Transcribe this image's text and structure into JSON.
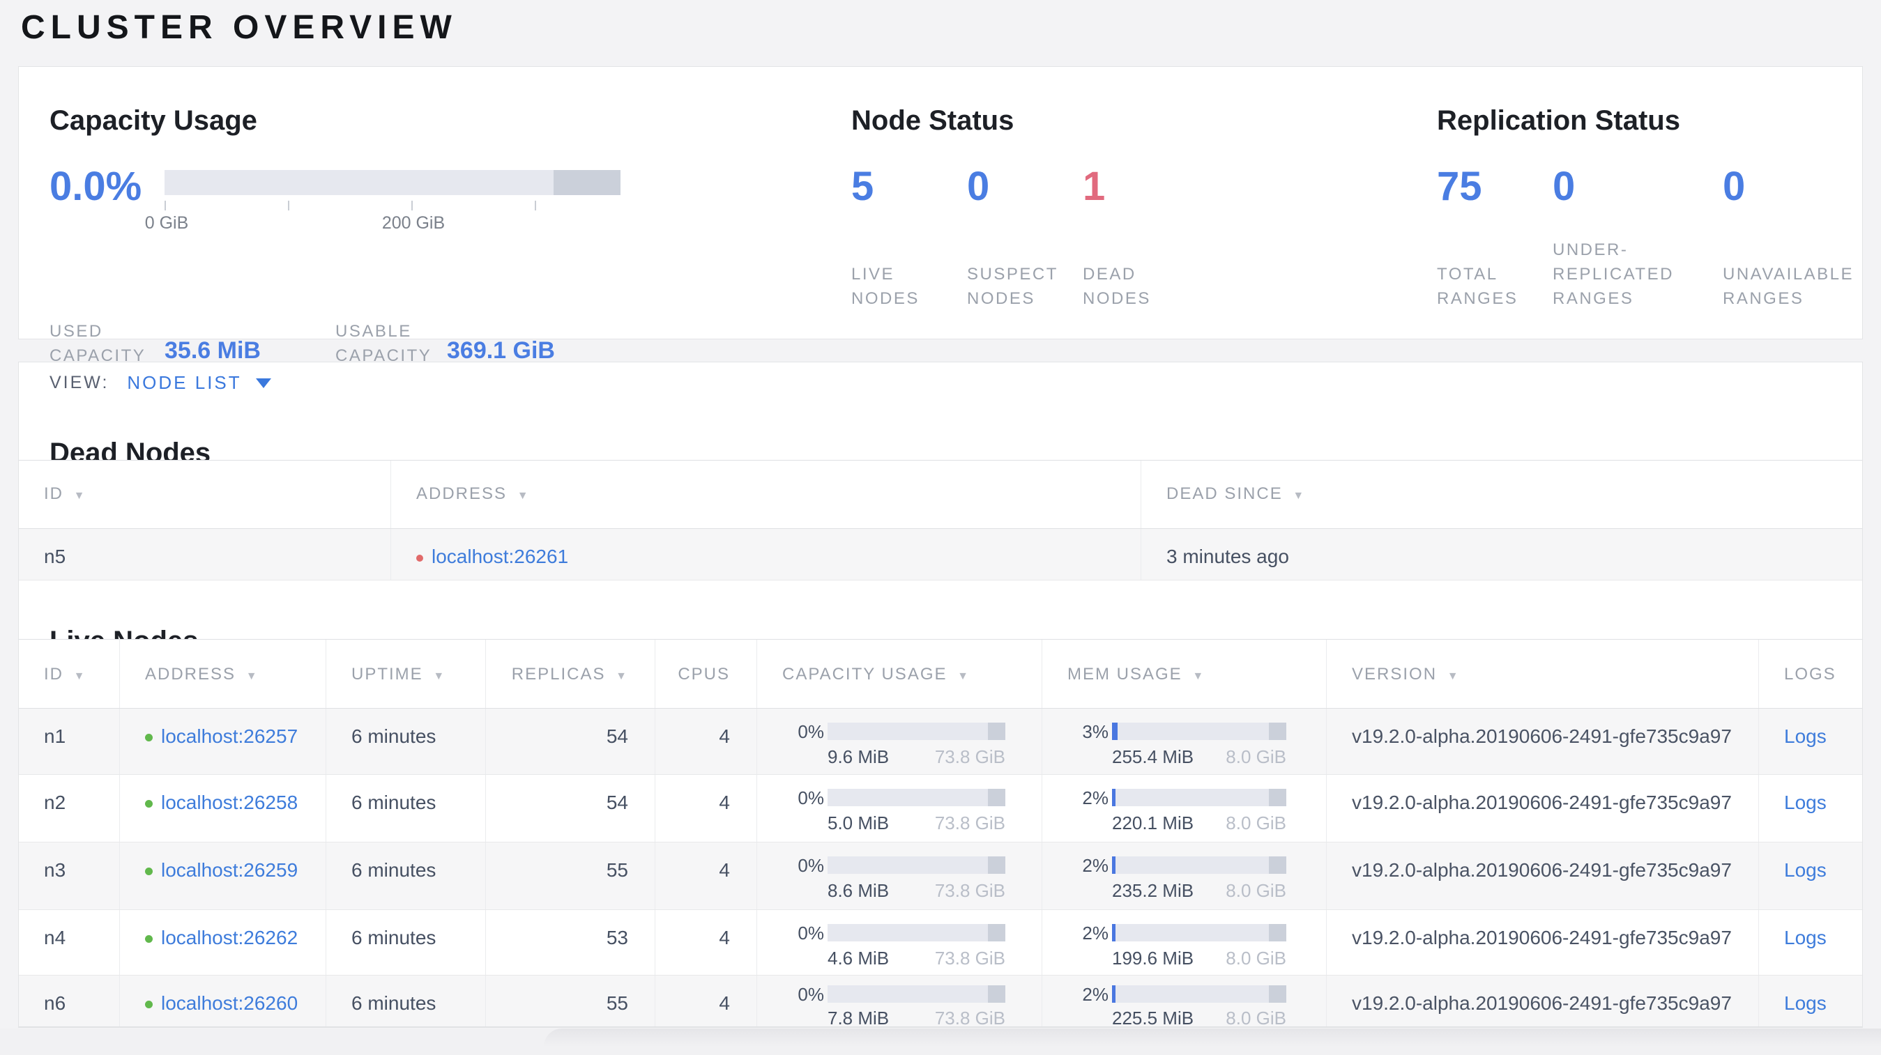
{
  "page_title": "CLUSTER OVERVIEW",
  "icons": {
    "sort_arrow": "▼",
    "live_dot": "green-circle",
    "dead_dot": "red-circle",
    "dropdown_caret": "triangle-down"
  },
  "colors": {
    "accent_blue": "#4a7de2",
    "link_blue": "#3e7cdb",
    "danger_red": "#e16a7e",
    "green_dot": "#61b84c",
    "red_dot": "#e16a6a",
    "bar_track": "#e6e8ef",
    "bar_dark": "#cbd0da",
    "bar_fill": "#4a77e0"
  },
  "summary": {
    "capacity": {
      "title": "Capacity Usage",
      "percent": "0.0%",
      "ticks": [
        "0 GiB",
        "200 GiB"
      ],
      "used_label": "USED CAPACITY",
      "used_value": "35.6 MiB",
      "usable_label": "USABLE CAPACITY",
      "usable_value": "369.1 GiB"
    },
    "node_status": {
      "title": "Node Status",
      "stats": [
        {
          "value": "5",
          "label": "LIVE NODES"
        },
        {
          "value": "0",
          "label": "SUSPECT NODES"
        },
        {
          "value": "1",
          "label": "DEAD NODES"
        }
      ]
    },
    "replication": {
      "title": "Replication Status",
      "stats": [
        {
          "value": "75",
          "label": "TOTAL RANGES"
        },
        {
          "value": "0",
          "label": "UNDER-REPLICATED RANGES"
        },
        {
          "value": "0",
          "label": "UNAVAILABLE RANGES"
        }
      ]
    }
  },
  "view_bar": {
    "label": "VIEW:",
    "selected": "NODE LIST"
  },
  "dead_nodes": {
    "title": "Dead Nodes",
    "columns": [
      {
        "label": "ID",
        "sortable": true
      },
      {
        "label": "ADDRESS",
        "sortable": true
      },
      {
        "label": "DEAD SINCE",
        "sortable": true
      }
    ],
    "rows": [
      {
        "id": "n5",
        "address": "localhost:26261",
        "dead_since": "3 minutes ago"
      }
    ]
  },
  "live_nodes": {
    "title": "Live Nodes",
    "columns": [
      {
        "label": "ID",
        "sortable": true
      },
      {
        "label": "ADDRESS",
        "sortable": true
      },
      {
        "label": "UPTIME",
        "sortable": true
      },
      {
        "label": "REPLICAS",
        "sortable": true
      },
      {
        "label": "CPUS",
        "sortable": false
      },
      {
        "label": "CAPACITY USAGE",
        "sortable": true
      },
      {
        "label": "MEM USAGE",
        "sortable": true
      },
      {
        "label": "VERSION",
        "sortable": true
      },
      {
        "label": "LOGS",
        "sortable": false
      }
    ],
    "logs_label": "Logs",
    "rows": [
      {
        "id": "n1",
        "address": "localhost:26257",
        "uptime": "6 minutes",
        "replicas": "54",
        "cpus": "4",
        "capacity_percent": "0%",
        "capacity_fill": 0,
        "capacity_used": "9.6 MiB",
        "capacity_total": "73.8 GiB",
        "mem_percent": "3%",
        "mem_fill": 3,
        "mem_used": "255.4 MiB",
        "mem_total": "8.0 GiB",
        "version": "v19.2.0-alpha.20190606-2491-gfe735c9a97",
        "logs": "Logs"
      },
      {
        "id": "n2",
        "address": "localhost:26258",
        "uptime": "6 minutes",
        "replicas": "54",
        "cpus": "4",
        "capacity_percent": "0%",
        "capacity_fill": 0,
        "capacity_used": "5.0 MiB",
        "capacity_total": "73.8 GiB",
        "mem_percent": "2%",
        "mem_fill": 2,
        "mem_used": "220.1 MiB",
        "mem_total": "8.0 GiB",
        "version": "v19.2.0-alpha.20190606-2491-gfe735c9a97",
        "logs": "Logs"
      },
      {
        "id": "n3",
        "address": "localhost:26259",
        "uptime": "6 minutes",
        "replicas": "55",
        "cpus": "4",
        "capacity_percent": "0%",
        "capacity_fill": 0,
        "capacity_used": "8.6 MiB",
        "capacity_total": "73.8 GiB",
        "mem_percent": "2%",
        "mem_fill": 2,
        "mem_used": "235.2 MiB",
        "mem_total": "8.0 GiB",
        "version": "v19.2.0-alpha.20190606-2491-gfe735c9a97",
        "logs": "Logs"
      },
      {
        "id": "n4",
        "address": "localhost:26262",
        "uptime": "6 minutes",
        "replicas": "53",
        "cpus": "4",
        "capacity_percent": "0%",
        "capacity_fill": 0,
        "capacity_used": "4.6 MiB",
        "capacity_total": "73.8 GiB",
        "mem_percent": "2%",
        "mem_fill": 2,
        "mem_used": "199.6 MiB",
        "mem_total": "8.0 GiB",
        "version": "v19.2.0-alpha.20190606-2491-gfe735c9a97",
        "logs": "Logs"
      },
      {
        "id": "n6",
        "address": "localhost:26260",
        "uptime": "6 minutes",
        "replicas": "55",
        "cpus": "4",
        "capacity_percent": "0%",
        "capacity_fill": 0,
        "capacity_used": "7.8 MiB",
        "capacity_total": "73.8 GiB",
        "mem_percent": "2%",
        "mem_fill": 2,
        "mem_used": "225.5 MiB",
        "mem_total": "8.0 GiB",
        "version": "v19.2.0-alpha.20190606-2491-gfe735c9a97",
        "logs": "Logs"
      }
    ]
  }
}
